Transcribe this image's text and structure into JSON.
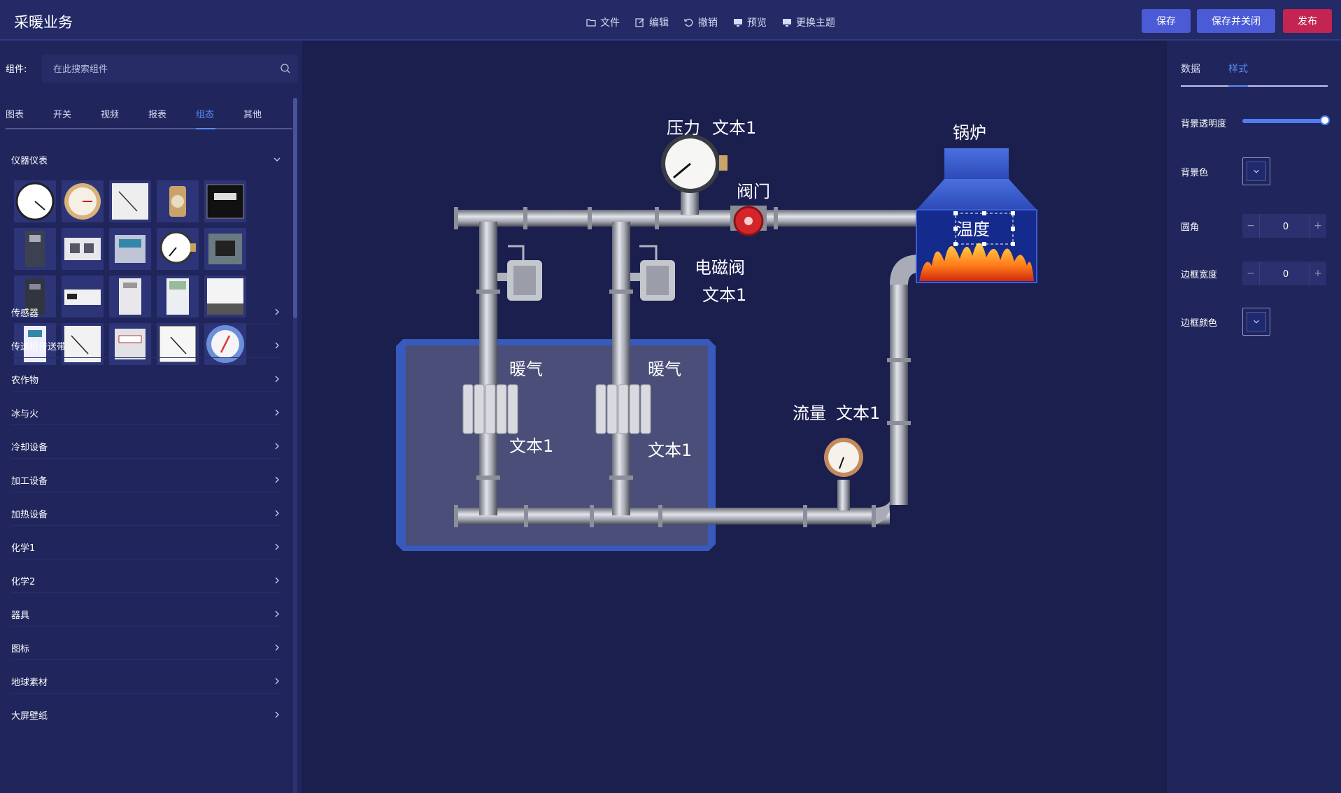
{
  "header": {
    "title": "采暖业务",
    "menu": [
      {
        "label": "文件",
        "icon": "folder-icon"
      },
      {
        "label": "编辑",
        "icon": "edit-icon"
      },
      {
        "label": "撤销",
        "icon": "undo-icon"
      },
      {
        "label": "预览",
        "icon": "monitor-icon"
      },
      {
        "label": "更换主题",
        "icon": "monitor-icon"
      }
    ],
    "buttons": {
      "save": "保存",
      "save_close": "保存并关闭",
      "publish": "发布"
    },
    "colors": {
      "save": "#4b5bd6",
      "publish": "#c42452"
    }
  },
  "left": {
    "search_label": "组件:",
    "search_placeholder": "在此搜索组件",
    "tabs": [
      "图表",
      "开关",
      "视频",
      "报表",
      "组态",
      "其他"
    ],
    "active_tab": "组态",
    "expanded_category": "仪器仪表",
    "gallery_count": 20,
    "categories": [
      "传感器",
      "传送机传送带",
      "农作物",
      "冰与火",
      "冷却设备",
      "加工设备",
      "加热设备",
      "化学1",
      "化学2",
      "器具",
      "图标",
      "地球素材",
      "大屏壁纸"
    ]
  },
  "canvas": {
    "labels": {
      "pressure": "压力",
      "pressure_text": "文本1",
      "valve": "阀门",
      "boiler": "锅炉",
      "temperature": "温度",
      "solenoid": "电磁阀",
      "solenoid_text": "文本1",
      "heat1": "暖气",
      "heat1_text": "文本1",
      "heat2": "暖气",
      "heat2_text": "文本1",
      "flow": "流量",
      "flow_text": "文本1"
    }
  },
  "right": {
    "tabs": [
      "数据",
      "样式"
    ],
    "active_tab": "样式",
    "fields": {
      "bg_opacity": "背景透明度",
      "bg_color": "背景色",
      "radius": "圆角",
      "border_width": "边框宽度",
      "border_color": "边框颜色"
    },
    "bg_opacity_value": 1.0,
    "radius_value": "0",
    "border_width_value": "0",
    "accent": "#4f7ef0"
  }
}
